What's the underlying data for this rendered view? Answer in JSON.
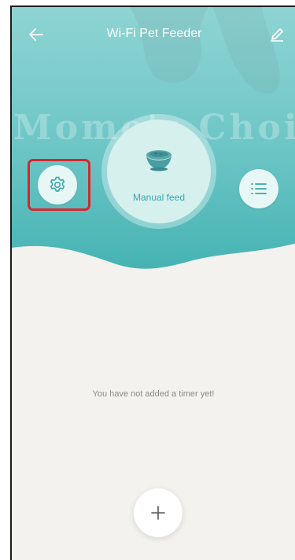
{
  "header": {
    "title": "Wi-Fi Pet Feeder",
    "back_icon": "back-arrow-icon",
    "edit_icon": "pencil-icon"
  },
  "hero": {
    "watermark": "Momo's Choi",
    "manual_feed_label": "Manual feed",
    "settings_icon": "gear-icon",
    "list_icon": "list-icon",
    "bowl_icon": "pet-bowl-icon"
  },
  "timers": {
    "empty_message": "You have not added a timer yet!",
    "add_icon": "plus-icon"
  },
  "colors": {
    "teal_light": "#8fd4d4",
    "teal_dark": "#46b3b3",
    "accent_text": "#3aa8a8",
    "content_bg": "#f3f2ee",
    "highlight": "#d8262c"
  }
}
